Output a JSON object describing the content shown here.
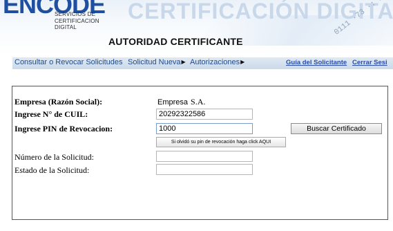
{
  "header": {
    "logo_text": "ENCODE",
    "logo_subtitle_lines": [
      "SERVICIOS DE",
      "CERTIFICACION",
      "DIGITAL"
    ],
    "banner_text": "CERTIFICACIÓN DIGITA",
    "page_title": "AUTORIDAD CERTIFICANTE"
  },
  "nav": {
    "items": [
      {
        "label": "Consultar o Revocar Solicitudes"
      },
      {
        "label": "Solicitud Nueva",
        "arrow": "▶"
      },
      {
        "label": "Autorizaciones",
        "arrow": "▶"
      }
    ],
    "right_links": [
      {
        "label": "Guía del Solicitante"
      },
      {
        "label": "Cerrar Sesi"
      }
    ]
  },
  "form": {
    "empresa": {
      "label": "Empresa (Razón Social):",
      "value": "Empresa",
      "suffix": "S.A."
    },
    "cuil": {
      "label": "Ingrese N° de CUIL:",
      "value": "20292322586"
    },
    "pin": {
      "label": "Ingrese PIN de Revocacion:",
      "value": "1000"
    },
    "buscar_button": "Buscar Certificado",
    "forgot_button": "Si olvidó su pin de revocación haga click AQUI",
    "numero_solicitud": {
      "label": "Número de la Solicitud:",
      "value": ""
    },
    "estado_solicitud": {
      "label": "Estado de la Solicitud:",
      "value": ""
    }
  },
  "colors": {
    "nav_bg": "#cbd9e8",
    "nav_text": "#1f4a8a",
    "link": "#2b4da8",
    "logo": "#1e4fa0"
  }
}
